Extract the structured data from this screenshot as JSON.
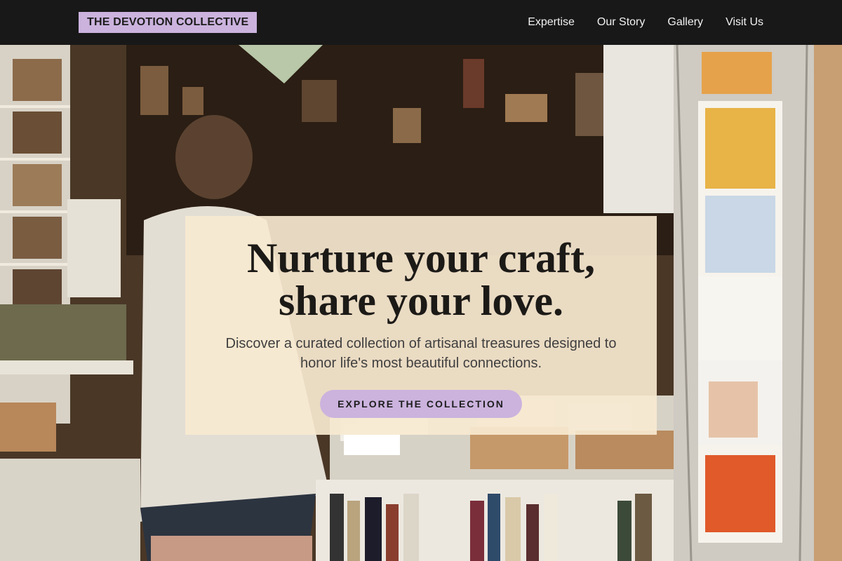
{
  "nav": {
    "logo": "THE DEVOTION COLLECTIVE",
    "links": [
      "Expertise",
      "Our Story",
      "Gallery",
      "Visit Us"
    ]
  },
  "hero": {
    "headline": "Nurture your craft, share your love.",
    "subtitle": "Discover a curated collection of artisanal treasures designed to honor life's most beautiful connections.",
    "cta_label": "EXPLORE THE COLLECTION"
  },
  "colors": {
    "nav_bg": "#181818",
    "accent": "#cbb3de",
    "card_bg": "#f7e9d0",
    "text_dark": "#1c1a17"
  }
}
